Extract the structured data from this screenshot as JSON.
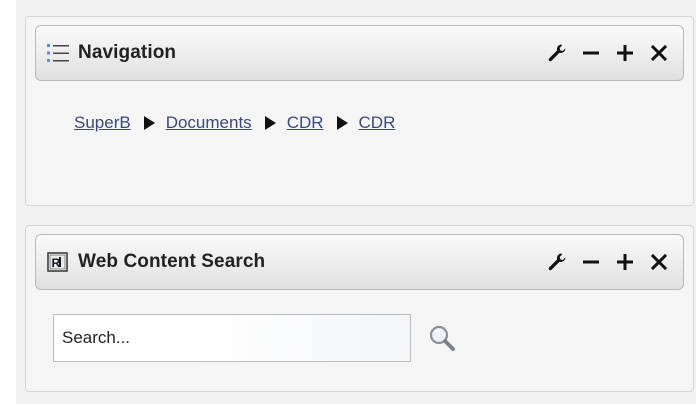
{
  "navigation_portlet": {
    "title": "Navigation",
    "title_icon": "list-icon",
    "controls": [
      {
        "name": "configure",
        "icon": "wrench-icon"
      },
      {
        "name": "minimize",
        "icon": "minus-icon"
      },
      {
        "name": "maximize",
        "icon": "plus-icon"
      },
      {
        "name": "close",
        "icon": "close-icon"
      }
    ],
    "breadcrumb": [
      "SuperB",
      "Documents",
      "CDR",
      "CDR"
    ]
  },
  "search_portlet": {
    "title": "Web Content Search",
    "title_icon": "search-content-icon",
    "controls": [
      {
        "name": "configure",
        "icon": "wrench-icon"
      },
      {
        "name": "minimize",
        "icon": "minus-icon"
      },
      {
        "name": "maximize",
        "icon": "plus-icon"
      },
      {
        "name": "close",
        "icon": "close-icon"
      }
    ],
    "search_placeholder": "Search...",
    "search_button_icon": "magnifier-icon"
  },
  "colors": {
    "link": "#3a4a7a",
    "title_text": "#222222",
    "list_icon_bullets": "#5b8ed6"
  }
}
